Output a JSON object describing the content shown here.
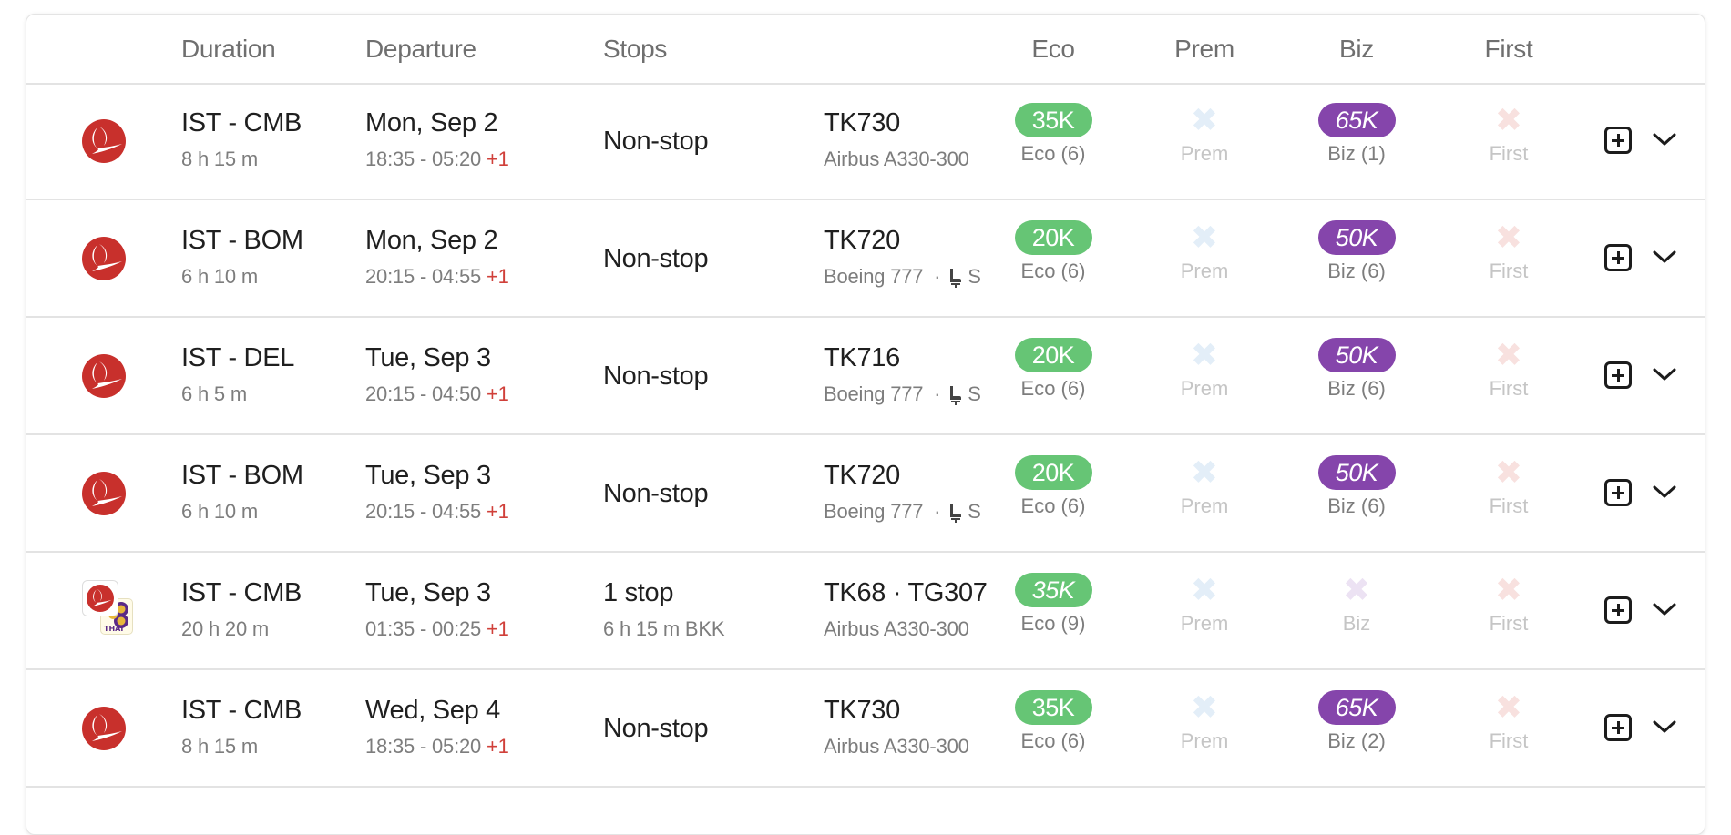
{
  "header": {
    "duration": "Duration",
    "departure": "Departure",
    "stops": "Stops",
    "eco": "Eco",
    "prem": "Prem",
    "biz": "Biz",
    "first": "First"
  },
  "colors": {
    "eco_pill": "#66c575",
    "biz_pill": "#8545ab",
    "plus_day": "#d0403a",
    "tk_red": "#c8302c"
  },
  "rows": [
    {
      "logo": "turkish-airlines",
      "route": "IST - CMB",
      "duration": "8 h 15 m",
      "date": "Mon, Sep 2",
      "times": "18:35 - 05:20",
      "plus_day": "+1",
      "stops": "Non-stop",
      "stop_detail": "",
      "flight": "TK730",
      "aircraft": "Airbus A330-300",
      "seat_note": "",
      "eco": {
        "available": true,
        "price": "35K",
        "label": "Eco (6)"
      },
      "prem": {
        "available": false,
        "label": "Prem"
      },
      "biz": {
        "available": true,
        "price": "65K",
        "label": "Biz (1)"
      },
      "first": {
        "available": false,
        "label": "First"
      }
    },
    {
      "logo": "turkish-airlines",
      "route": "IST - BOM",
      "duration": "6 h 10 m",
      "date": "Mon, Sep 2",
      "times": "20:15 - 04:55",
      "plus_day": "+1",
      "stops": "Non-stop",
      "stop_detail": "",
      "flight": "TK720",
      "aircraft": "Boeing 777",
      "seat_note": "S",
      "eco": {
        "available": true,
        "price": "20K",
        "label": "Eco (6)"
      },
      "prem": {
        "available": false,
        "label": "Prem"
      },
      "biz": {
        "available": true,
        "price": "50K",
        "label": "Biz (6)"
      },
      "first": {
        "available": false,
        "label": "First"
      }
    },
    {
      "logo": "turkish-airlines",
      "route": "IST - DEL",
      "duration": "6 h 5 m",
      "date": "Tue, Sep 3",
      "times": "20:15 - 04:50",
      "plus_day": "+1",
      "stops": "Non-stop",
      "stop_detail": "",
      "flight": "TK716",
      "aircraft": "Boeing 777",
      "seat_note": "S",
      "eco": {
        "available": true,
        "price": "20K",
        "label": "Eco (6)"
      },
      "prem": {
        "available": false,
        "label": "Prem"
      },
      "biz": {
        "available": true,
        "price": "50K",
        "label": "Biz (6)"
      },
      "first": {
        "available": false,
        "label": "First"
      }
    },
    {
      "logo": "turkish-airlines",
      "route": "IST - BOM",
      "duration": "6 h 10 m",
      "date": "Tue, Sep 3",
      "times": "20:15 - 04:55",
      "plus_day": "+1",
      "stops": "Non-stop",
      "stop_detail": "",
      "flight": "TK720",
      "aircraft": "Boeing 777",
      "seat_note": "S",
      "eco": {
        "available": true,
        "price": "20K",
        "label": "Eco (6)"
      },
      "prem": {
        "available": false,
        "label": "Prem"
      },
      "biz": {
        "available": true,
        "price": "50K",
        "label": "Biz (6)"
      },
      "first": {
        "available": false,
        "label": "First"
      }
    },
    {
      "logo": "turkish-airlines+thai",
      "route": "IST - CMB",
      "duration": "20 h 20 m",
      "date": "Tue, Sep 3",
      "times": "01:35 - 00:25",
      "plus_day": "+1",
      "stops": "1 stop",
      "stop_detail": "6 h 15 m  BKK",
      "flight": "TK68  ·  TG307",
      "aircraft": "Airbus A330-300",
      "seat_note": "",
      "eco": {
        "available": true,
        "price": "35K",
        "label": "Eco (9)",
        "mixed": true
      },
      "prem": {
        "available": false,
        "label": "Prem"
      },
      "biz": {
        "available": false,
        "label": "Biz"
      },
      "first": {
        "available": false,
        "label": "First"
      }
    },
    {
      "logo": "turkish-airlines",
      "route": "IST - CMB",
      "duration": "8 h 15 m",
      "date": "Wed, Sep 4",
      "times": "18:35 - 05:20",
      "plus_day": "+1",
      "stops": "Non-stop",
      "stop_detail": "",
      "flight": "TK730",
      "aircraft": "Airbus A330-300",
      "seat_note": "",
      "eco": {
        "available": true,
        "price": "35K",
        "label": "Eco (6)"
      },
      "prem": {
        "available": false,
        "label": "Prem"
      },
      "biz": {
        "available": true,
        "price": "65K",
        "label": "Biz (2)"
      },
      "first": {
        "available": false,
        "label": "First"
      }
    }
  ],
  "icons": {
    "unavailable": "✖",
    "add": "plus-square-icon",
    "expand": "chevron-down-icon",
    "seat": "seat-icon"
  }
}
